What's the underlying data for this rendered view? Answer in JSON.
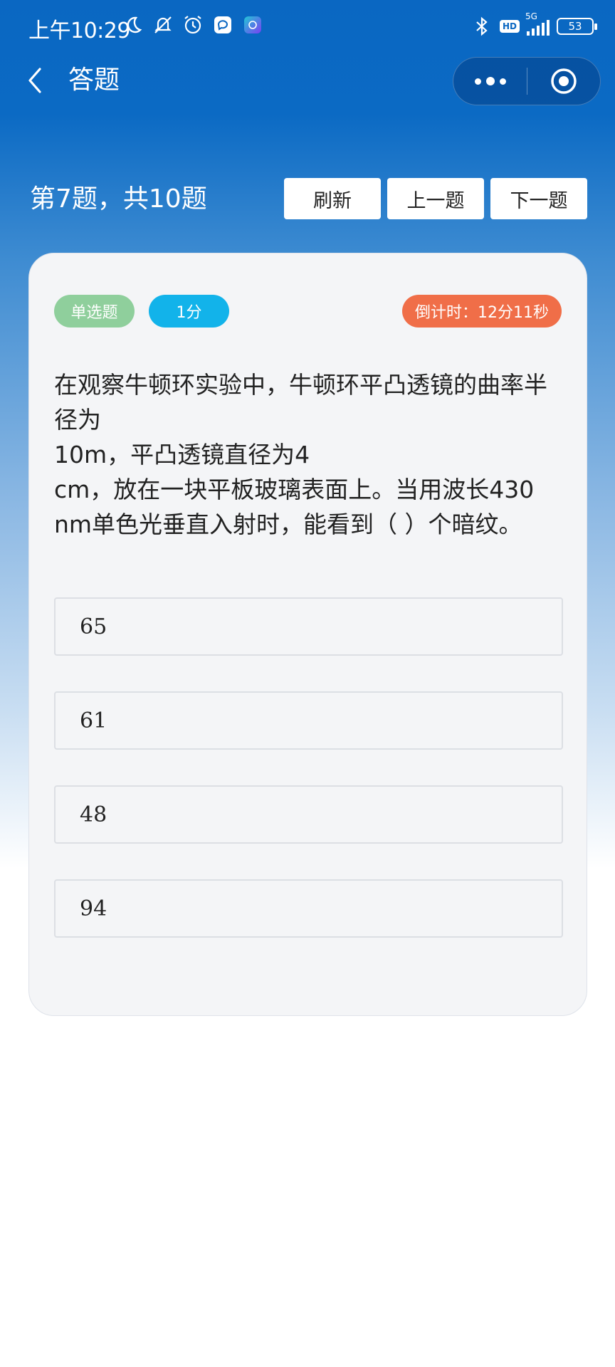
{
  "status_bar": {
    "time": "上午10:29",
    "network": "5G",
    "hd": "HD",
    "battery": "53",
    "icons": [
      "moon-icon",
      "mute-bell-icon",
      "alarm-icon",
      "app-notification-icon",
      "canva-app-icon",
      "bluetooth-icon",
      "signal-icon"
    ]
  },
  "nav": {
    "title": "答题",
    "back_icon": "chevron-left-icon",
    "more_icon": "more-dots-icon",
    "close_icon": "target-close-icon"
  },
  "progress": {
    "text": "第7题，共10题",
    "buttons": {
      "refresh": "刷新",
      "prev": "上一题",
      "next": "下一题"
    }
  },
  "question": {
    "type_tag": "单选题",
    "score_tag": "1分",
    "timer": "倒计时：12分11秒",
    "text": "在观察牛顿环实验中，牛顿环平凸透镜的曲率半径为\n10m，平凸透镜直径为4\ncm，放在一块平板玻璃表面上。当用波长430\nnm单色光垂直入射时，能看到（   ）个暗纹。",
    "options": [
      "65",
      "61",
      "48",
      "94"
    ]
  },
  "colors": {
    "header_blue": "#0a67c2",
    "tag_type": "#8fcf9c",
    "tag_score": "#12b3ea",
    "tag_timer": "#f06e48",
    "card_bg": "#f4f5f7"
  }
}
